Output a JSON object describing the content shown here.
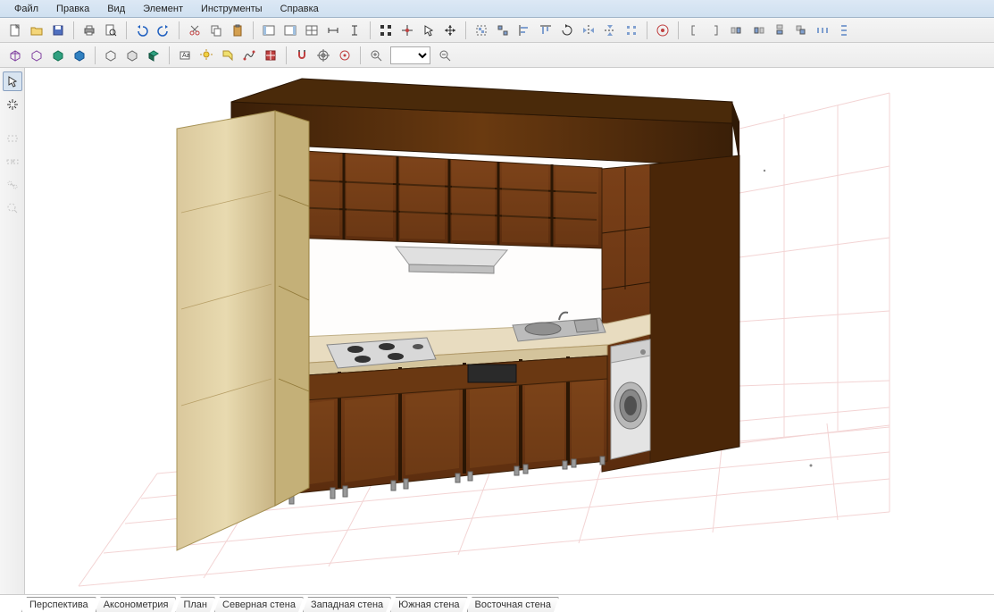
{
  "menu": {
    "items": [
      "Файл",
      "Правка",
      "Вид",
      "Элемент",
      "Инструменты",
      "Справка"
    ]
  },
  "toolbar1": {
    "groups": [
      [
        "new-doc",
        "open-doc",
        "save-doc"
      ],
      [
        "print-doc",
        "print-preview"
      ],
      [
        "undo",
        "redo",
        "separator-small"
      ],
      [
        "cut",
        "copy",
        "paste"
      ],
      [
        "layer-panel",
        "catalog-panel",
        "materials-panel",
        "dimension-h",
        "dimension-v"
      ],
      [
        "select-all",
        "snap-end",
        "pointer",
        "hand-move"
      ],
      [
        "group-ops",
        "ungroup",
        "measure-x",
        "measure-y",
        "align-center",
        "mirror-h"
      ],
      [
        "mirror-v",
        "rotate-cw",
        "help-info"
      ],
      [
        "bracket-l",
        "bracket-r",
        "clone-1",
        "clone-2",
        "clone-3",
        "clone-stack",
        "distribute-h",
        "distribute-v"
      ]
    ]
  },
  "toolbar2": {
    "groups": [
      [
        "view-3d-1",
        "view-3d-2",
        "view-3d-3",
        "view-3d-4"
      ],
      [
        "wire-1",
        "wire-2",
        "wire-3"
      ],
      [
        "text-tool",
        "light-tool",
        "tag-tool",
        "path-tool",
        "grid-tool"
      ],
      [
        "magnet-snap",
        "target-snap",
        "target-snap-2"
      ],
      [
        "zoom-in"
      ],
      [
        "zoom-dropdown"
      ],
      [
        "zoom-out"
      ]
    ]
  },
  "side_toolbar": {
    "items": [
      "arrow-select",
      "light-burst",
      "sep",
      "rect-dashed",
      "link-dashed",
      "chain-dashed",
      "search-dashed"
    ]
  },
  "tabs": {
    "items": [
      "Перспектива",
      "Аксонометрия",
      "План",
      "Северная стена",
      "Западная стена",
      "Южная стена",
      "Восточная стена"
    ],
    "active": 0
  },
  "colors": {
    "menubar_bg": "#dce8f5",
    "toolbar_bg": "#f0f0f0",
    "wood_dark": "#6b3410",
    "wood_light": "#d4c090",
    "accent_top": "#5a3208"
  }
}
